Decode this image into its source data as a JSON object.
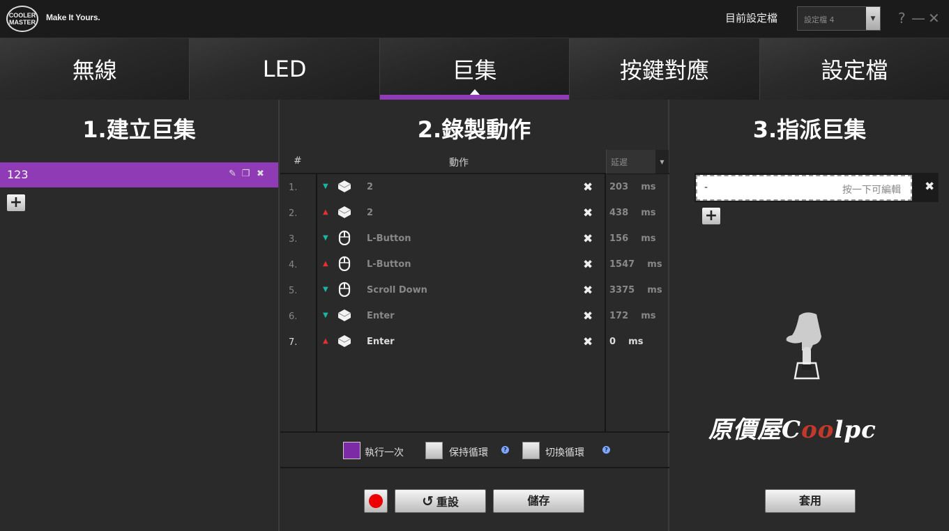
{
  "brand": {
    "logo_line1": "COOLER",
    "logo_line2": "MASTER",
    "tagline": "Make It Yours."
  },
  "header": {
    "profile_label": "目前設定檔",
    "profile_value": "設定檔 4",
    "help_label": "?",
    "minimize_label": "—",
    "close_label": "✕"
  },
  "tabs": [
    {
      "label": "無線",
      "active": false
    },
    {
      "label": "LED",
      "active": false
    },
    {
      "label": "巨集",
      "active": true
    },
    {
      "label": "按鍵對應",
      "active": false
    },
    {
      "label": "設定檔",
      "active": false
    }
  ],
  "create_panel": {
    "title": "1.建立巨集",
    "macros": [
      {
        "name": "123",
        "selected": true
      }
    ],
    "add_label": "+"
  },
  "record_panel": {
    "title": "2.錄製動作",
    "columns": {
      "index": "#",
      "action": "動作",
      "delay": "延遲"
    },
    "rows": [
      {
        "index": "1.",
        "direction": "down",
        "device": "key",
        "action": "2",
        "delay": "203",
        "unit": "ms"
      },
      {
        "index": "2.",
        "direction": "up",
        "device": "key",
        "action": "2",
        "delay": "438",
        "unit": "ms"
      },
      {
        "index": "3.",
        "direction": "down",
        "device": "mouse",
        "action": "L-Button",
        "delay": "156",
        "unit": "ms"
      },
      {
        "index": "4.",
        "direction": "up",
        "device": "mouse",
        "action": "L-Button",
        "delay": "1547",
        "unit": "ms"
      },
      {
        "index": "5.",
        "direction": "down",
        "device": "mouse",
        "action": "Scroll Down",
        "delay": "3375",
        "unit": "ms"
      },
      {
        "index": "6.",
        "direction": "down",
        "device": "key",
        "action": "Enter",
        "delay": "172",
        "unit": "ms"
      },
      {
        "index": "7.",
        "direction": "up",
        "device": "key",
        "action": "Enter",
        "delay": "0",
        "unit": "ms"
      }
    ],
    "options": [
      {
        "label": "執行一次",
        "checked": true
      },
      {
        "label": "保持循環",
        "checked": false
      },
      {
        "label": "切換循環",
        "checked": false
      }
    ],
    "help_glyph": "?",
    "reset_label": "重設",
    "save_label": "儲存"
  },
  "assign_panel": {
    "title": "3.指派巨集",
    "field_value": "-",
    "field_hint": "按一下可編輯",
    "add_label": "+",
    "apply_label": "套用"
  },
  "watermark": {
    "part1": "原價屋",
    "part2": "C",
    "part3": "oo",
    "part4": "lpc"
  },
  "colors": {
    "accent": "#8e3bb5",
    "arrow_down": "#1ab5a5",
    "arrow_up": "#e53030",
    "record": "#e00000"
  }
}
